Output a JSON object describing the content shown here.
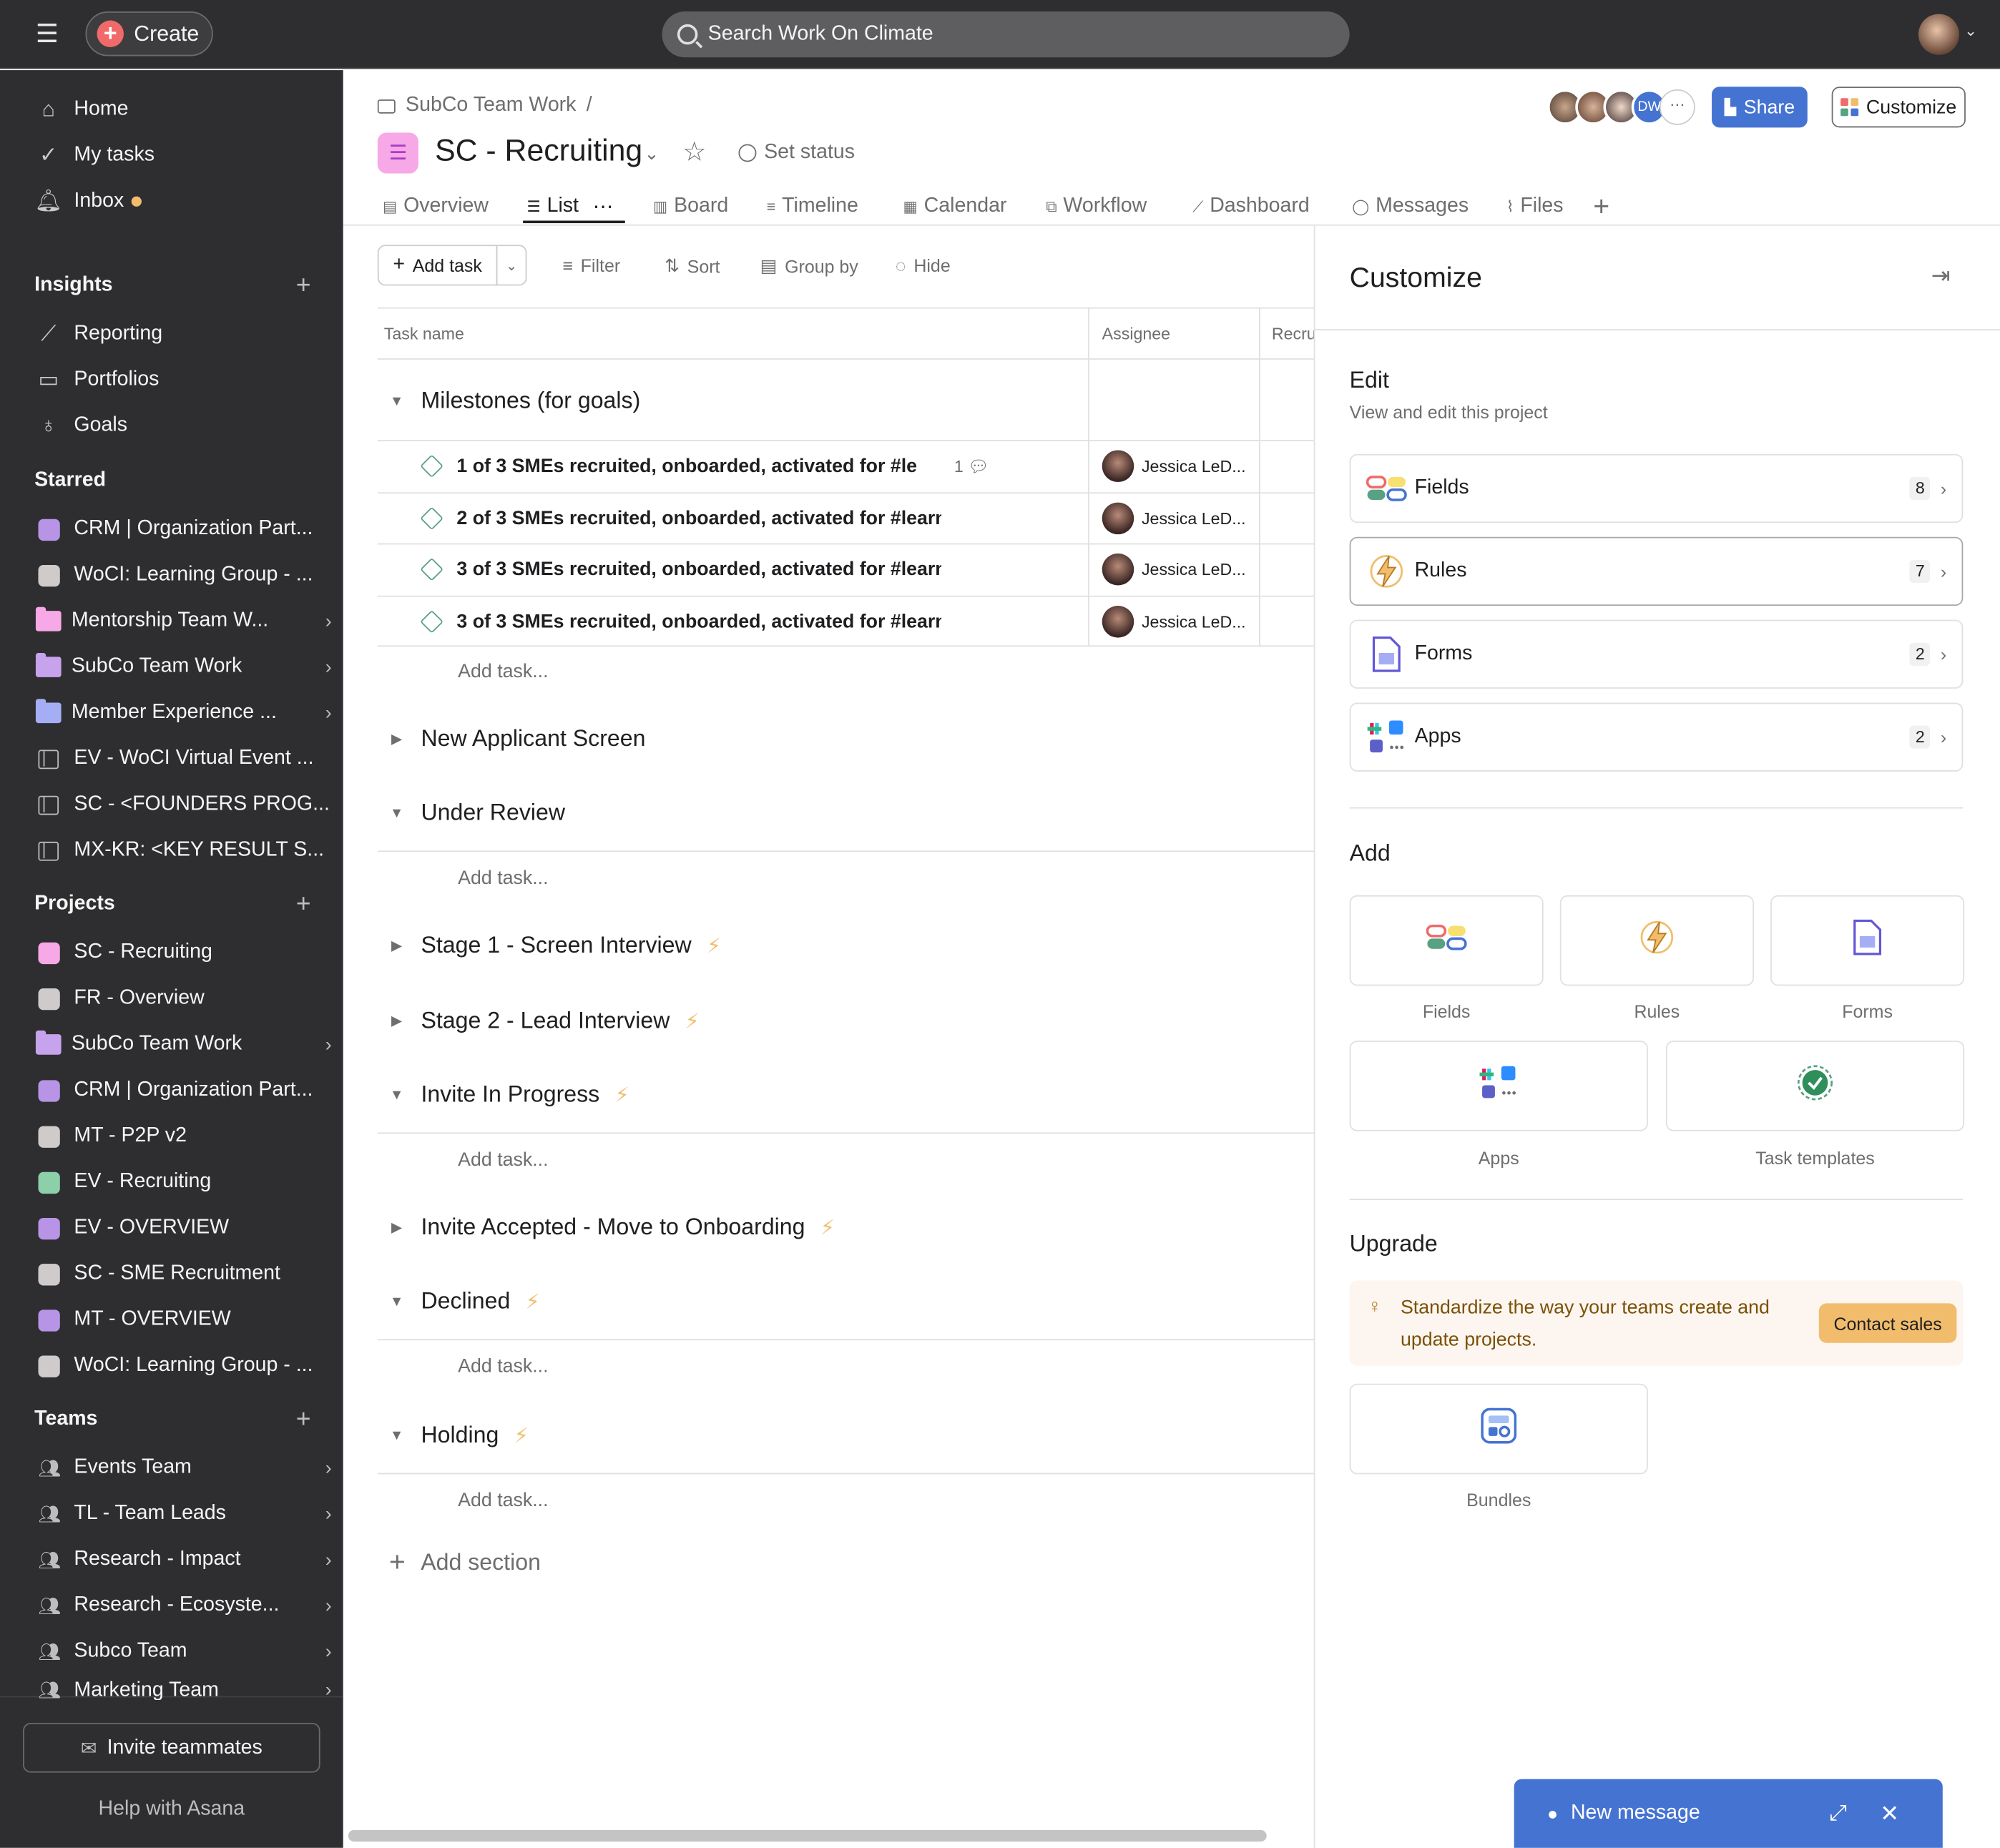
{
  "topbar": {
    "create_label": "Create",
    "search_placeholder": "Search Work On Climate"
  },
  "sidebar": {
    "nav": [
      {
        "label": "Home",
        "icon": "home-icon"
      },
      {
        "label": "My tasks",
        "icon": "check-circle-icon"
      },
      {
        "label": "Inbox",
        "icon": "bell-icon",
        "badge_color": "#f1bd6c"
      }
    ],
    "insights": {
      "title": "Insights",
      "items": [
        "Reporting",
        "Portfolios",
        "Goals"
      ]
    },
    "starred": {
      "title": "Starred",
      "items": [
        {
          "label": "CRM | Organization Part...",
          "kind": "square",
          "color": "#b894e6"
        },
        {
          "label": "WoCI: Learning Group - ...",
          "kind": "square",
          "color": "#cfcbcb"
        },
        {
          "label": "Mentorship Team W...",
          "kind": "folder",
          "color": "#f7a8e6",
          "chevron": true
        },
        {
          "label": "SubCo Team Work",
          "kind": "folder",
          "color": "#c6a3ec",
          "chevron": true
        },
        {
          "label": "Member Experience ...",
          "kind": "folder",
          "color": "#a5aef5",
          "chevron": true
        },
        {
          "label": "EV - WoCI Virtual Event ...",
          "kind": "table"
        },
        {
          "label": "SC - <FOUNDERS PROG...",
          "kind": "table"
        },
        {
          "label": "MX-KR: <KEY RESULT S...",
          "kind": "table"
        }
      ]
    },
    "projects": {
      "title": "Projects",
      "items": [
        {
          "label": "SC - Recruiting",
          "kind": "square",
          "color": "#f7a8e6"
        },
        {
          "label": "FR - Overview",
          "kind": "square",
          "color": "#cfcbcb"
        },
        {
          "label": "SubCo Team Work",
          "kind": "folder",
          "color": "#c6a3ec",
          "chevron": true
        },
        {
          "label": "CRM | Organization Part...",
          "kind": "square",
          "color": "#b894e6"
        },
        {
          "label": "MT - P2P v2",
          "kind": "square",
          "color": "#cfcbcb"
        },
        {
          "label": "EV - Recruiting",
          "kind": "square",
          "color": "#8ccfa9"
        },
        {
          "label": "EV - OVERVIEW",
          "kind": "square",
          "color": "#b894e6"
        },
        {
          "label": "SC - SME Recruitment",
          "kind": "square",
          "color": "#cfcbcb"
        },
        {
          "label": "MT - OVERVIEW",
          "kind": "square",
          "color": "#b894e6"
        },
        {
          "label": "WoCI: Learning Group - ...",
          "kind": "square",
          "color": "#cfcbcb"
        }
      ]
    },
    "teams": {
      "title": "Teams",
      "items": [
        "Events Team",
        "TL - Team Leads",
        "Research - Impact",
        "Research - Ecosyste...",
        "Subco Team",
        "Marketing Team"
      ]
    },
    "invite_label": "Invite teammates",
    "help_label": "Help with Asana"
  },
  "project": {
    "breadcrumb": "SubCo Team Work",
    "breadcrumb_sep": "/",
    "title": "SC - Recruiting",
    "set_status": "Set status",
    "member_initials": "DW",
    "share_label": "Share",
    "customize_label": "Customize",
    "tabs": [
      "Overview",
      "List",
      "Board",
      "Timeline",
      "Calendar",
      "Workflow",
      "Dashboard",
      "Messages",
      "Files"
    ]
  },
  "toolbar": {
    "add_task": "Add task",
    "filter": "Filter",
    "sort": "Sort",
    "group_by": "Group by",
    "hide": "Hide"
  },
  "table": {
    "headers": [
      "Task name",
      "Assignee",
      "Recru"
    ],
    "add_task_label": "Add task...",
    "add_section_label": "Add section",
    "sections": [
      {
        "name": "Milestones (for goals)",
        "expanded": true,
        "rule": false
      },
      {
        "name": "New Applicant Screen",
        "expanded": false,
        "rule": false
      },
      {
        "name": "Under Review",
        "expanded": true,
        "rule": false
      },
      {
        "name": "Stage 1 - Screen Interview",
        "expanded": false,
        "rule": true
      },
      {
        "name": "Stage 2 - Lead Interview",
        "expanded": false,
        "rule": true
      },
      {
        "name": "Invite In Progress",
        "expanded": true,
        "rule": true
      },
      {
        "name": "Invite Accepted - Move to Onboarding",
        "expanded": false,
        "rule": true
      },
      {
        "name": "Declined",
        "expanded": true,
        "rule": true
      },
      {
        "name": "Holding",
        "expanded": true,
        "rule": true
      }
    ],
    "tasks": [
      {
        "name": "1 of 3 SMEs recruited, onboarded, activated for #le",
        "comments": "1",
        "assignee": "Jessica LeD..."
      },
      {
        "name": "2 of 3 SMEs recruited, onboarded, activated for #learn-",
        "assignee": "Jessica LeD..."
      },
      {
        "name": "3 of 3 SMEs recruited, onboarded, activated for #learn-",
        "assignee": "Jessica LeD..."
      },
      {
        "name": "3 of 3 SMEs recruited, onboarded, activated for #learn-",
        "assignee": "Jessica LeD..."
      }
    ]
  },
  "customize": {
    "title": "Customize",
    "edit": {
      "title": "Edit",
      "subtitle": "View and edit this project",
      "cards": [
        {
          "label": "Fields",
          "count": "8",
          "icon": "fields-icon"
        },
        {
          "label": "Rules",
          "count": "7",
          "icon": "rules-icon"
        },
        {
          "label": "Forms",
          "count": "2",
          "icon": "forms-icon"
        },
        {
          "label": "Apps",
          "count": "2",
          "icon": "apps-icon"
        }
      ]
    },
    "add": {
      "title": "Add",
      "tiles": [
        "Fields",
        "Rules",
        "Forms",
        "Apps",
        "Task templates"
      ]
    },
    "upgrade": {
      "title": "Upgrade",
      "text": "Standardize the way your teams create and update projects.",
      "button": "Contact sales",
      "bundles": "Bundles"
    }
  },
  "new_message": {
    "label": "New message"
  },
  "colors": {
    "accent": "#4573d2",
    "rule": "#f1bd6c",
    "sidebar": "#2e2e30"
  }
}
